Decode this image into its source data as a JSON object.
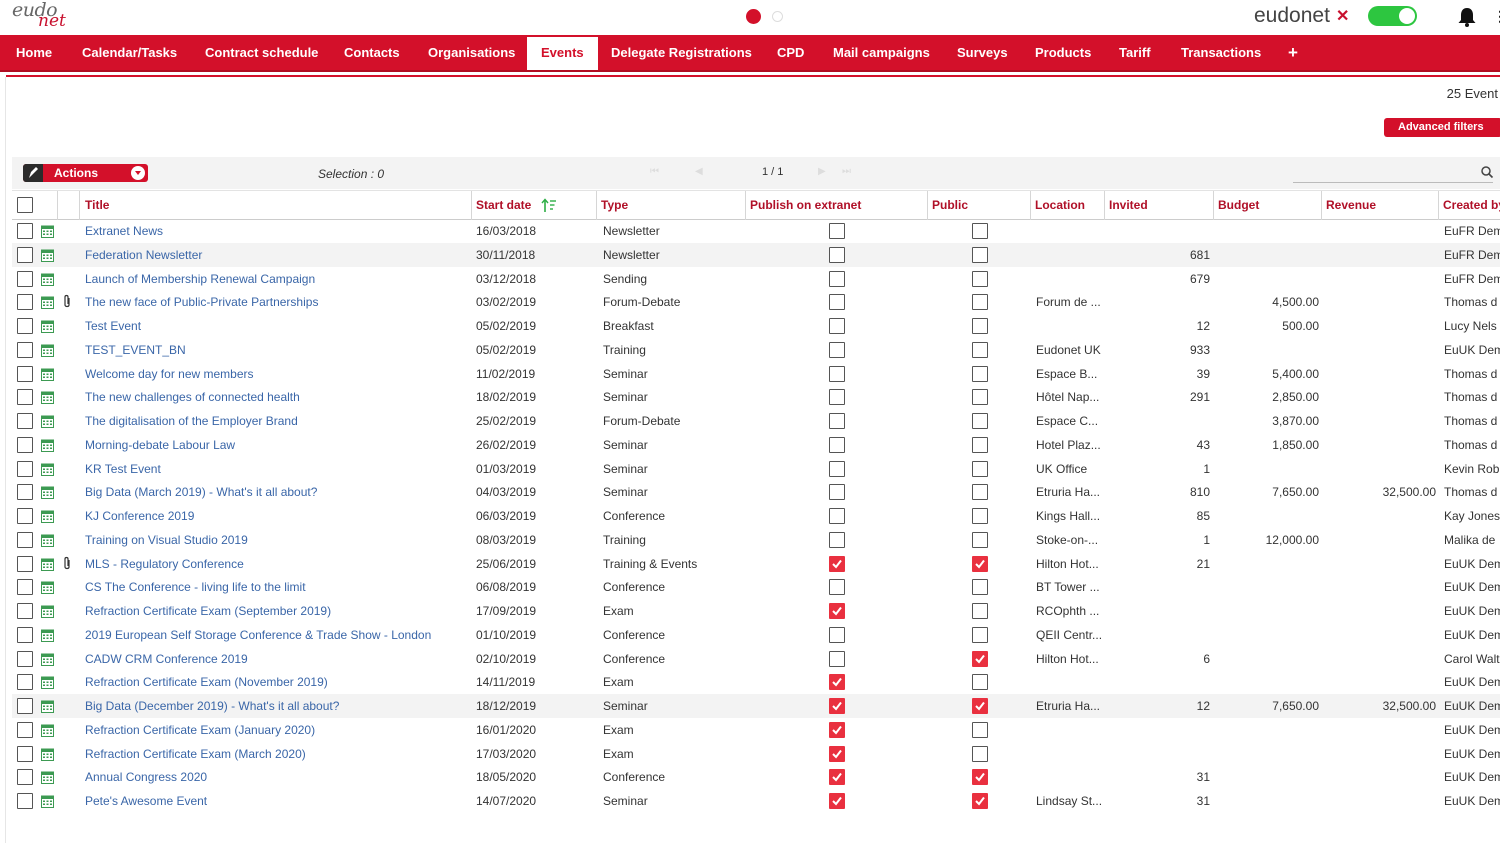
{
  "header": {
    "logo_top": "eudo",
    "logo_bottom": "net",
    "brand": "eudonet",
    "brand_mark": "✕",
    "toggle_on": true,
    "menu_glyph": "⋮"
  },
  "nav": {
    "tabs": [
      {
        "label": "Home",
        "active": false
      },
      {
        "label": "Calendar/Tasks",
        "active": false
      },
      {
        "label": "Contract schedule",
        "active": false
      },
      {
        "label": "Contacts",
        "active": false
      },
      {
        "label": "Organisations",
        "active": false
      },
      {
        "label": "Events",
        "active": true
      },
      {
        "label": "Delegate Registrations",
        "active": false
      },
      {
        "label": "CPD",
        "active": false
      },
      {
        "label": "Mail campaigns",
        "active": false
      },
      {
        "label": "Surveys",
        "active": false
      },
      {
        "label": "Products",
        "active": false
      },
      {
        "label": "Tariff",
        "active": false
      },
      {
        "label": "Transactions",
        "active": false
      }
    ],
    "add_label": "+"
  },
  "list": {
    "count": "25 Event",
    "advanced_filters": "Advanced filters",
    "actions_label": "Actions",
    "selection": "Selection : 0",
    "pager": "1 / 1",
    "search_placeholder": ""
  },
  "colors": {
    "accent": "#d3102a",
    "link": "#3a66a8",
    "check_on": "#e9303f",
    "toggle": "#2dc640"
  },
  "columns": [
    "Title",
    "Start date",
    "Type",
    "Publish on extranet",
    "Public",
    "Location",
    "Invited",
    "Budget",
    "Revenue",
    "Created by"
  ],
  "rows": [
    {
      "title": "Extranet News",
      "date": "16/03/2018",
      "type": "Newsletter",
      "publish": false,
      "public": false,
      "location": "",
      "invited": "",
      "budget": "",
      "revenue": "",
      "created": "EuFR Dem",
      "clip": false
    },
    {
      "title": "Federation Newsletter",
      "date": "30/11/2018",
      "type": "Newsletter",
      "publish": false,
      "public": false,
      "location": "",
      "invited": "681",
      "budget": "",
      "revenue": "",
      "created": "EuFR Dem",
      "clip": false
    },
    {
      "title": "Launch of Membership Renewal Campaign",
      "date": "03/12/2018",
      "type": "Sending",
      "publish": false,
      "public": false,
      "location": "",
      "invited": "679",
      "budget": "",
      "revenue": "",
      "created": "EuFR Dem",
      "clip": false
    },
    {
      "title": "The new face of Public-Private Partnerships",
      "date": "03/02/2019",
      "type": "Forum-Debate",
      "publish": false,
      "public": false,
      "location": "Forum de ...",
      "invited": "",
      "budget": "4,500.00",
      "revenue": "",
      "created": "Thomas d",
      "clip": true
    },
    {
      "title": "Test Event",
      "date": "05/02/2019",
      "type": "Breakfast",
      "publish": false,
      "public": false,
      "location": "",
      "invited": "12",
      "budget": "500.00",
      "revenue": "",
      "created": "Lucy Nels",
      "clip": false
    },
    {
      "title": "TEST_EVENT_BN",
      "date": "05/02/2019",
      "type": "Training",
      "publish": false,
      "public": false,
      "location": "Eudonet UK",
      "invited": "933",
      "budget": "",
      "revenue": "",
      "created": "EuUK Dem",
      "clip": false
    },
    {
      "title": "Welcome day for new members",
      "date": "11/02/2019",
      "type": "Seminar",
      "publish": false,
      "public": false,
      "location": "Espace B...",
      "invited": "39",
      "budget": "5,400.00",
      "revenue": "",
      "created": "Thomas d",
      "clip": false
    },
    {
      "title": "The new challenges of connected health",
      "date": "18/02/2019",
      "type": "Seminar",
      "publish": false,
      "public": false,
      "location": "Hôtel Nap...",
      "invited": "291",
      "budget": "2,850.00",
      "revenue": "",
      "created": "Thomas d",
      "clip": false
    },
    {
      "title": "The digitalisation of the Employer Brand",
      "date": "25/02/2019",
      "type": "Forum-Debate",
      "publish": false,
      "public": false,
      "location": "Espace C...",
      "invited": "",
      "budget": "3,870.00",
      "revenue": "",
      "created": "Thomas d",
      "clip": false
    },
    {
      "title": "Morning-debate Labour Law",
      "date": "26/02/2019",
      "type": "Seminar",
      "publish": false,
      "public": false,
      "location": "Hotel Plaz...",
      "invited": "43",
      "budget": "1,850.00",
      "revenue": "",
      "created": "Thomas d",
      "clip": false
    },
    {
      "title": "KR Test Event",
      "date": "01/03/2019",
      "type": "Seminar",
      "publish": false,
      "public": false,
      "location": "UK Office",
      "invited": "1",
      "budget": "",
      "revenue": "",
      "created": "Kevin Rob",
      "clip": false
    },
    {
      "title": "Big Data (March 2019) - What's it all about?",
      "date": "04/03/2019",
      "type": "Seminar",
      "publish": false,
      "public": false,
      "location": "Etruria Ha...",
      "invited": "810",
      "budget": "7,650.00",
      "revenue": "32,500.00",
      "created": "Thomas d",
      "clip": false
    },
    {
      "title": "KJ Conference 2019",
      "date": "06/03/2019",
      "type": "Conference",
      "publish": false,
      "public": false,
      "location": "Kings Hall...",
      "invited": "85",
      "budget": "",
      "revenue": "",
      "created": "Kay Jones",
      "clip": false
    },
    {
      "title": "Training on Visual Studio 2019",
      "date": "08/03/2019",
      "type": "Training",
      "publish": false,
      "public": false,
      "location": "Stoke-on-...",
      "invited": "1",
      "budget": "12,000.00",
      "revenue": "",
      "created": "Malika de",
      "clip": false
    },
    {
      "title": "MLS - Regulatory Conference",
      "date": "25/06/2019",
      "type": "Training & Events",
      "publish": true,
      "public": true,
      "location": "Hilton Hot...",
      "invited": "21",
      "budget": "",
      "revenue": "",
      "created": "EuUK Dem",
      "clip": true
    },
    {
      "title": "CS The Conference - living life to the limit",
      "date": "06/08/2019",
      "type": "Conference",
      "publish": false,
      "public": false,
      "location": "BT Tower ...",
      "invited": "",
      "budget": "",
      "revenue": "",
      "created": "EuUK Dem",
      "clip": false
    },
    {
      "title": "Refraction Certificate Exam (September 2019)",
      "date": "17/09/2019",
      "type": "Exam",
      "publish": true,
      "public": false,
      "location": "RCOphth ...",
      "invited": "",
      "budget": "",
      "revenue": "",
      "created": "EuUK Dem",
      "clip": false
    },
    {
      "title": "2019 European Self Storage Conference & Trade Show - London",
      "date": "01/10/2019",
      "type": "Conference",
      "publish": false,
      "public": false,
      "location": "QEII Centr...",
      "invited": "",
      "budget": "",
      "revenue": "",
      "created": "EuUK Dem",
      "clip": false
    },
    {
      "title": "CADW CRM Conference 2019",
      "date": "02/10/2019",
      "type": "Conference",
      "publish": false,
      "public": true,
      "location": "Hilton Hot...",
      "invited": "6",
      "budget": "",
      "revenue": "",
      "created": "Carol Walt",
      "clip": false
    },
    {
      "title": "Refraction Certificate Exam (November 2019)",
      "date": "14/11/2019",
      "type": "Exam",
      "publish": true,
      "public": false,
      "location": "",
      "invited": "",
      "budget": "",
      "revenue": "",
      "created": "EuUK Dem",
      "clip": false
    },
    {
      "title": "Big Data (December 2019) - What's it all about?",
      "date": "18/12/2019",
      "type": "Seminar",
      "publish": true,
      "public": true,
      "location": "Etruria Ha...",
      "invited": "12",
      "budget": "7,650.00",
      "revenue": "32,500.00",
      "created": "EuUK Dem",
      "clip": false
    },
    {
      "title": "Refraction Certificate Exam (January 2020)",
      "date": "16/01/2020",
      "type": "Exam",
      "publish": true,
      "public": false,
      "location": "",
      "invited": "",
      "budget": "",
      "revenue": "",
      "created": "EuUK Dem",
      "clip": false
    },
    {
      "title": "Refraction Certificate Exam (March 2020)",
      "date": "17/03/2020",
      "type": "Exam",
      "publish": true,
      "public": false,
      "location": "",
      "invited": "",
      "budget": "",
      "revenue": "",
      "created": "EuUK Dem",
      "clip": false
    },
    {
      "title": "Annual Congress 2020",
      "date": "18/05/2020",
      "type": "Conference",
      "publish": true,
      "public": true,
      "location": "",
      "invited": "31",
      "budget": "",
      "revenue": "",
      "created": "EuUK Dem",
      "clip": false
    },
    {
      "title": "Pete's Awesome Event",
      "date": "14/07/2020",
      "type": "Seminar",
      "publish": true,
      "public": true,
      "location": "Lindsay St...",
      "invited": "31",
      "budget": "",
      "revenue": "",
      "created": "EuUK Dem",
      "clip": false
    }
  ]
}
